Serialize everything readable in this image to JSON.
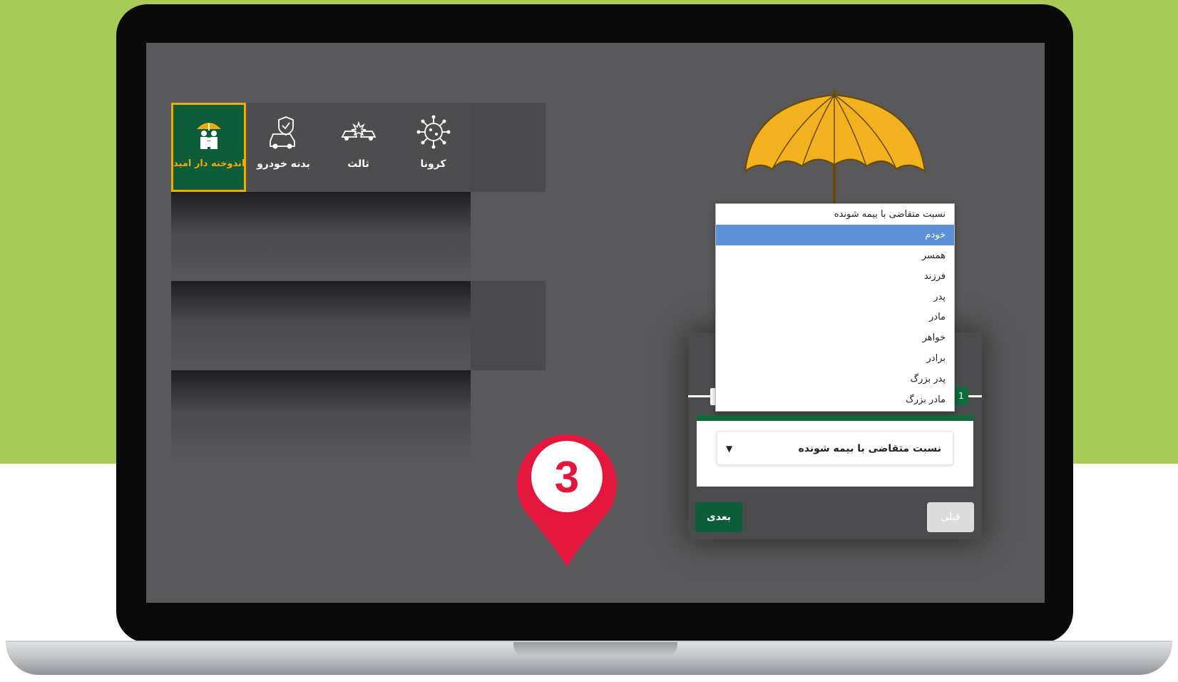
{
  "services": [
    {
      "label": "اندوخته دار امید",
      "icon": "family-umbrella-icon",
      "active": true
    },
    {
      "label": "بدنه خودرو",
      "icon": "car-shield-icon",
      "active": false
    },
    {
      "label": "ثالث",
      "icon": "car-crash-icon",
      "active": false
    },
    {
      "label": "کرونا",
      "icon": "virus-icon",
      "active": false
    }
  ],
  "step": {
    "number": "1"
  },
  "dropdown": {
    "header": "نسبت متقاضی با بیمه شونده",
    "options": [
      "خودم",
      "همسر",
      "فرزند",
      "پدر",
      "مادر",
      "خواهر",
      "برادر",
      "پدر بزرگ",
      "مادر بزرگ"
    ],
    "selected_index": 0
  },
  "select": {
    "value": "نسبت متقاضی با بیمه شونده"
  },
  "buttons": {
    "next": "بعدی",
    "prev": "قبلی"
  },
  "pin": {
    "number": "3"
  },
  "colors": {
    "background": "#a7cb56",
    "brand": "#0e5d3a",
    "accent": "#f2a900",
    "pin": "#e3173e",
    "highlight": "#5b8fd6"
  }
}
